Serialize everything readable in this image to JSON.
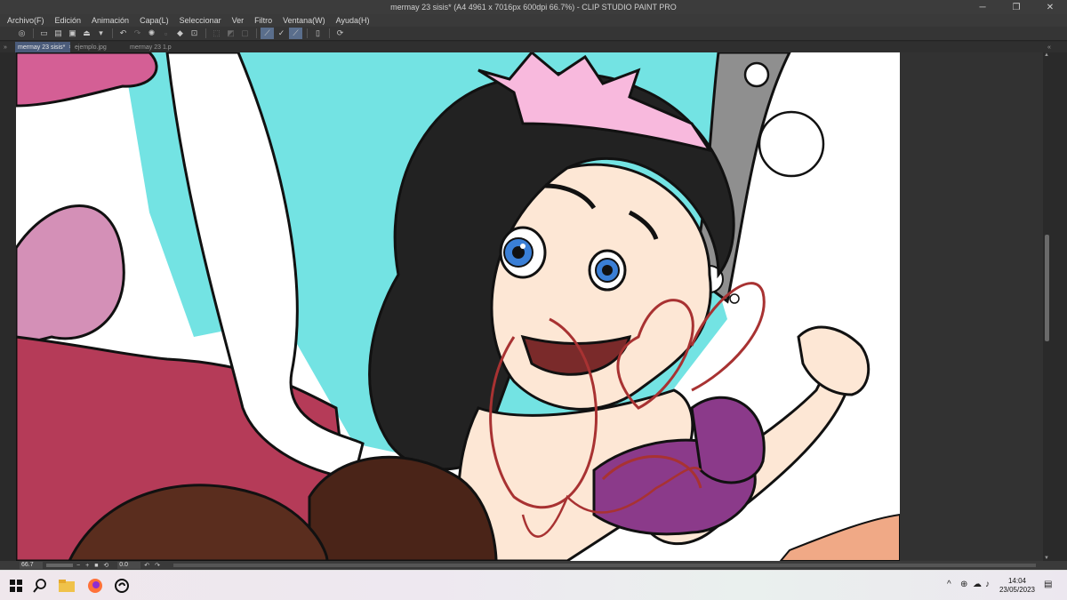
{
  "window": {
    "title": "mermay 23 sisis* (A4 4961 x 7016px 600dpi 66.7%)  - CLIP STUDIO PAINT PRO"
  },
  "menu": [
    "Archivo(F)",
    "Edición",
    "Animación",
    "Capa(L)",
    "Seleccionar",
    "Ver",
    "Filtro",
    "Ventana(W)",
    "Ayuda(H)"
  ],
  "tabs": [
    "mermay 23 sisis*",
    "ejemplo.jpg",
    "mermay 23 1.p"
  ],
  "status": {
    "zoom": "66.7",
    "rotation": "0.0"
  },
  "taskbar": {
    "time": "14:04",
    "date": "23/05/2023"
  },
  "icons": [
    "clip-studio-icon",
    "undo-icon",
    "redo-icon",
    "search-icon",
    "firefox-icon",
    "file-explorer-icon"
  ],
  "colors": {
    "active_tab": "#4a5b7a",
    "accent_toggle": "#5a6e8c"
  }
}
